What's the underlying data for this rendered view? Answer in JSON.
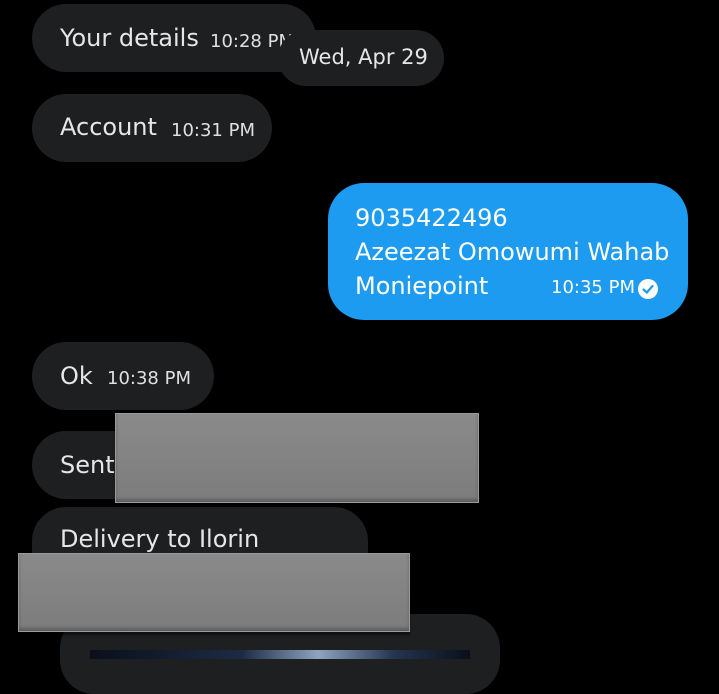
{
  "messages": {
    "your_details": {
      "text": "Your details",
      "time": "10:28 PM"
    },
    "date_separator": "Wed, Apr 29",
    "account": {
      "text": "Account",
      "time": "10:31 PM"
    },
    "outgoing": {
      "line1": "9035422496",
      "line2": "Azeezat Omowumi Wahab",
      "line3": "Moniepoint",
      "time": "10:35 PM",
      "status_icon": "read-check-icon"
    },
    "ok": {
      "text": "Ok",
      "time": "10:38 PM"
    },
    "sent": {
      "text": "Sent"
    },
    "delivery": {
      "text": "Delivery to Ilorin"
    }
  },
  "colors": {
    "background": "#000000",
    "incoming_bubble": "#1e1f21",
    "outgoing_bubble": "#1d9bf0",
    "redaction": "#838383"
  }
}
